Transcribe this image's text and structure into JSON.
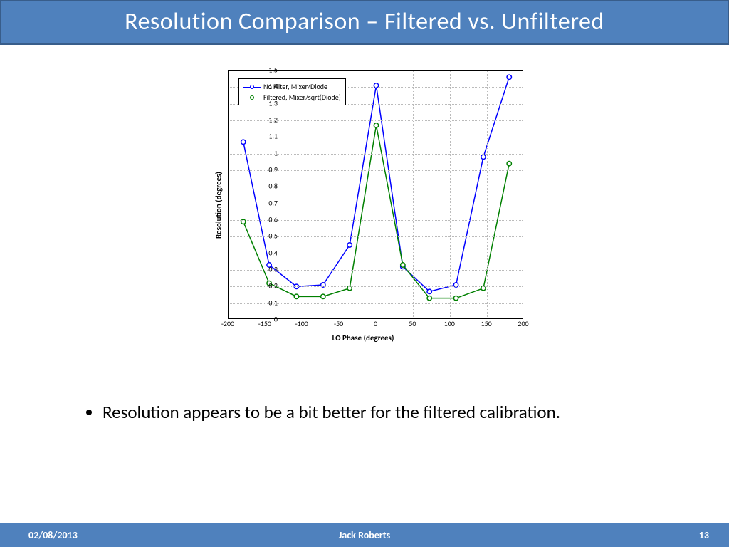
{
  "title": "Resolution Comparison – Filtered vs. Unfiltered",
  "bullet": "Resolution appears to be a bit better for the filtered calibration.",
  "footer": {
    "date": "02/08/2013",
    "author": "Jack Roberts",
    "page": "13"
  },
  "chart_data": {
    "type": "line",
    "xlabel": "LO Phase (degrees)",
    "ylabel": "Resolution (degrees)",
    "xlim": [
      -200,
      200
    ],
    "ylim": [
      0,
      1.5
    ],
    "x_ticks": [
      -200,
      -150,
      -100,
      -50,
      0,
      50,
      100,
      150,
      200
    ],
    "y_ticks": [
      0,
      0.1,
      0.2,
      0.3,
      0.4,
      0.5,
      0.6,
      0.7,
      0.8,
      0.9,
      1.0,
      1.1,
      1.2,
      1.3,
      1.4,
      1.5
    ],
    "x": [
      -180,
      -145,
      -108,
      -72,
      -36,
      0,
      36,
      72,
      108,
      145,
      180
    ],
    "series": [
      {
        "name": "No Filter, Mixer/Diode",
        "color": "#0000ff",
        "values": [
          1.07,
          0.33,
          0.2,
          0.21,
          0.45,
          1.41,
          0.32,
          0.17,
          0.21,
          0.98,
          1.46
        ]
      },
      {
        "name": "Filtered, Mixer/sqrt(Diode)",
        "color": "#008000",
        "values": [
          0.59,
          0.22,
          0.14,
          0.14,
          0.19,
          1.17,
          0.33,
          0.13,
          0.13,
          0.19,
          0.94
        ]
      }
    ],
    "legend_position": "upper-left",
    "grid": true
  }
}
